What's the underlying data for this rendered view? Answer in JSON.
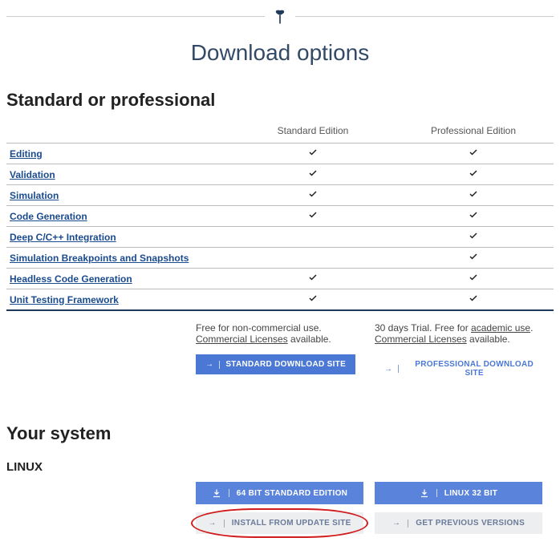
{
  "title": "Download options",
  "section_editions": "Standard or professional",
  "columns": {
    "std": "Standard Edition",
    "pro": "Professional Edition"
  },
  "features": [
    {
      "name": "Editing",
      "std": true,
      "pro": true
    },
    {
      "name": "Validation",
      "std": true,
      "pro": true
    },
    {
      "name": "Simulation",
      "std": true,
      "pro": true
    },
    {
      "name": "Code Generation",
      "std": true,
      "pro": true
    },
    {
      "name": "Deep C/C++ Integration",
      "std": false,
      "pro": true
    },
    {
      "name": "Simulation Breakpoints and Snapshots",
      "std": false,
      "pro": true
    },
    {
      "name": "Headless Code Generation",
      "std": true,
      "pro": true
    },
    {
      "name": "Unit Testing Framework",
      "std": true,
      "pro": true
    }
  ],
  "std_note_prefix": "Free for non-commercial use. ",
  "std_note_link": "Commercial Licenses",
  "std_note_suffix": " available.",
  "pro_note_prefix": "30 days Trial. Free for ",
  "pro_note_link1": "academic use",
  "pro_note_mid": ". ",
  "pro_note_link2": "Commercial Licenses",
  "pro_note_suffix": " available.",
  "btn_std_site": "Standard Download Site",
  "btn_pro_site": "Professional Download Site",
  "section_system": "Your system",
  "os": "LINUX",
  "btn_64bit": "64 Bit Standard Edition",
  "btn_32bit": "Linux 32 Bit",
  "btn_install_update": "Install From Update Site",
  "btn_prev_versions": "Get Previous Versions"
}
